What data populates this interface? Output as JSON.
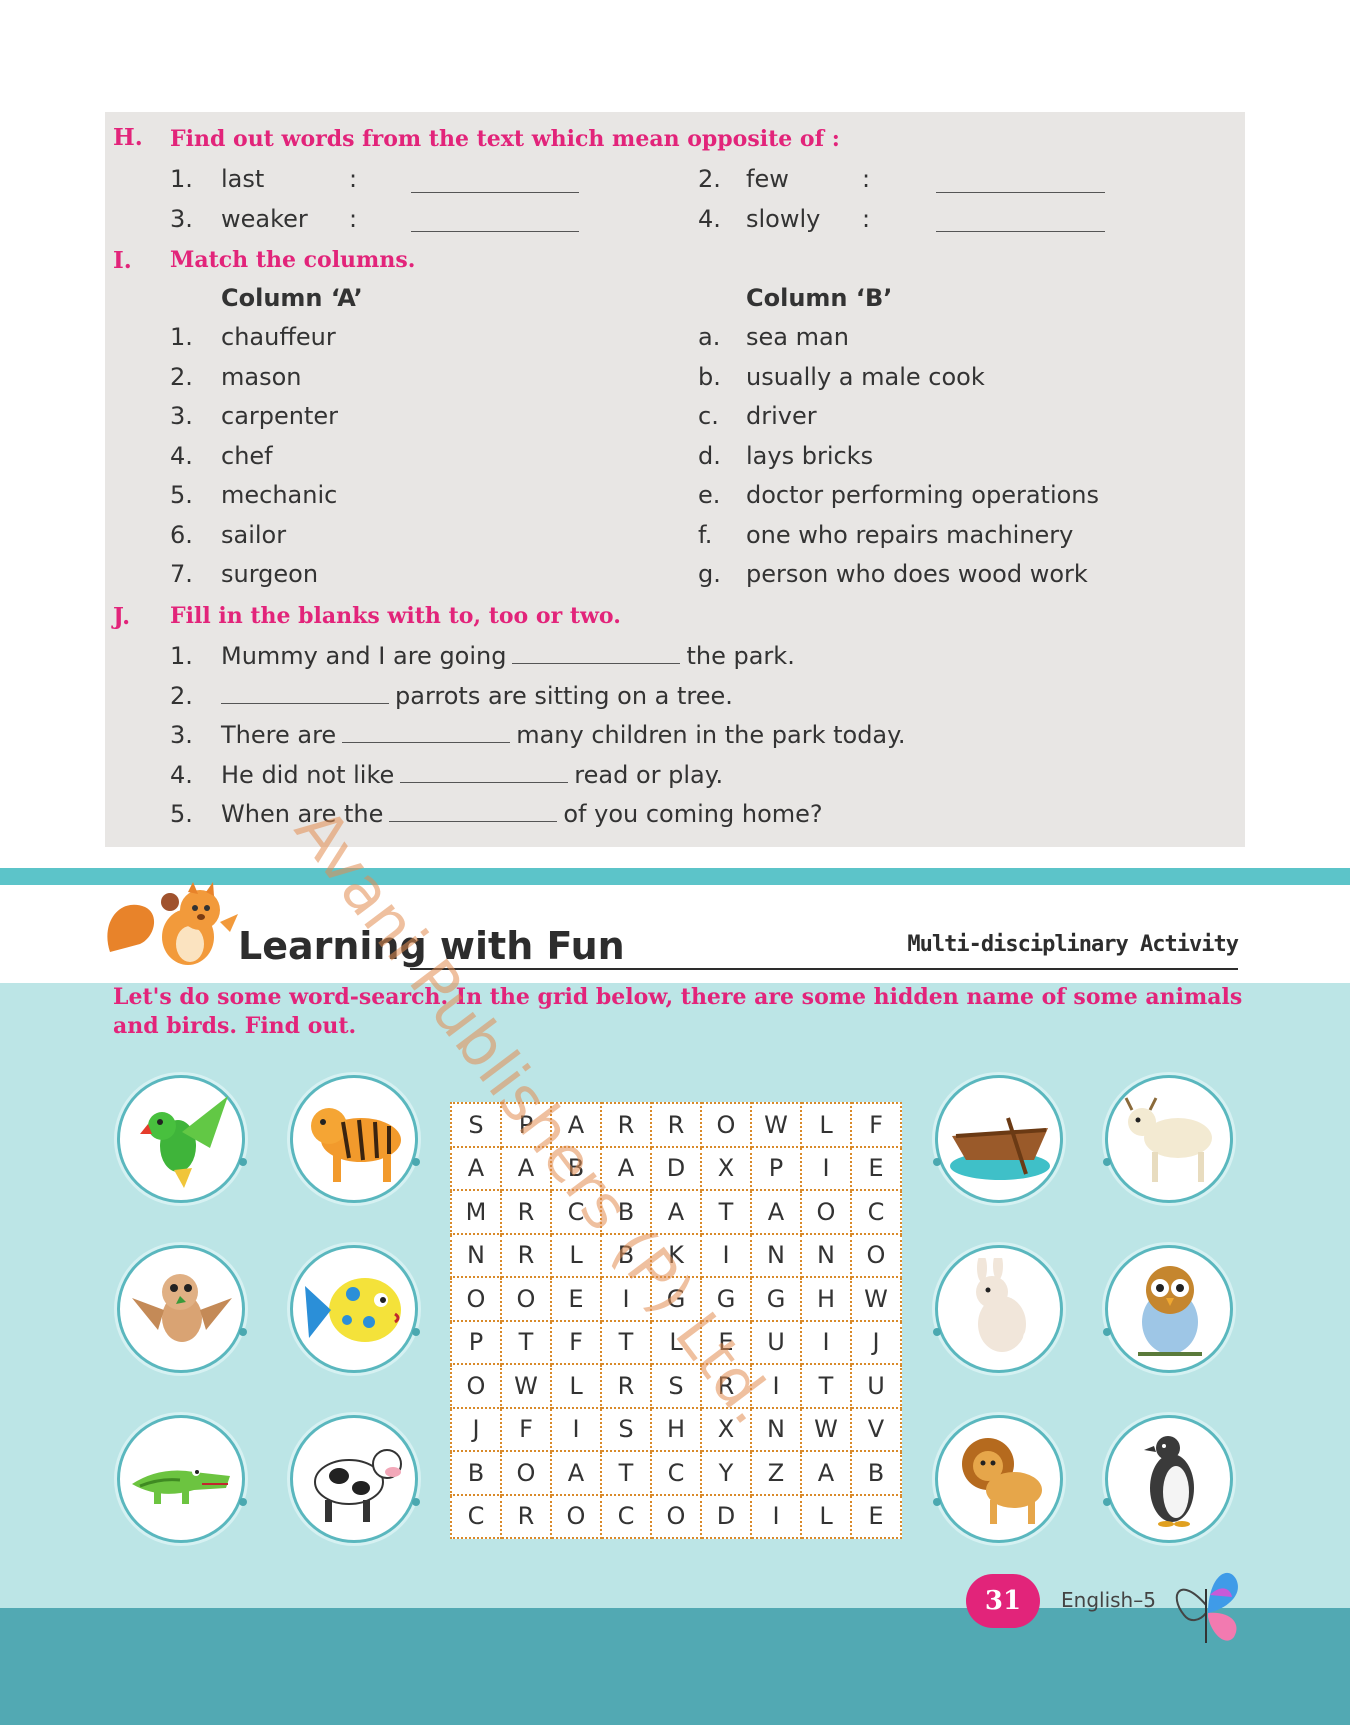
{
  "section_h": {
    "letter": "H.",
    "title": "Find out words from the text which mean opposite of :",
    "items": [
      {
        "num": "1.",
        "word": "last"
      },
      {
        "num": "2.",
        "word": "few"
      },
      {
        "num": "3.",
        "word": "weaker"
      },
      {
        "num": "4.",
        "word": "slowly"
      }
    ],
    "colon": ":"
  },
  "section_i": {
    "letter": "I.",
    "title": "Match the columns.",
    "col_a_head": "Column ‘A’",
    "col_b_head": "Column ‘B’",
    "col_a": [
      {
        "num": "1.",
        "text": "chauffeur"
      },
      {
        "num": "2.",
        "text": "mason"
      },
      {
        "num": "3.",
        "text": "carpenter"
      },
      {
        "num": "4.",
        "text": "chef"
      },
      {
        "num": "5.",
        "text": "mechanic"
      },
      {
        "num": "6.",
        "text": "sailor"
      },
      {
        "num": "7.",
        "text": "surgeon"
      }
    ],
    "col_b": [
      {
        "num": "a.",
        "text": "sea man"
      },
      {
        "num": "b.",
        "text": "usually a male cook"
      },
      {
        "num": "c.",
        "text": "driver"
      },
      {
        "num": "d.",
        "text": "lays bricks"
      },
      {
        "num": "e.",
        "text": "doctor performing operations"
      },
      {
        "num": "f.",
        "text": "one who repairs machinery"
      },
      {
        "num": "g.",
        "text": "person who does wood work"
      }
    ]
  },
  "section_j": {
    "letter": "J.",
    "title": "Fill in the blanks with to, too or two.",
    "items": [
      {
        "num": "1.",
        "before": "Mummy and I are going",
        "after": "the park."
      },
      {
        "num": "2.",
        "before": "",
        "after": "parrots are sitting on a tree."
      },
      {
        "num": "3.",
        "before": "There are",
        "after": "many children in the park today."
      },
      {
        "num": "4.",
        "before": "He did not like",
        "after": "read or play."
      },
      {
        "num": "5.",
        "before": "When are the",
        "after": "of you coming home?"
      }
    ]
  },
  "fun": {
    "title": "Learning with Fun",
    "tag": "Multi-disciplinary Activity",
    "instruction": "Let's do some word-search. In the grid below, there are some hidden name of some animals and birds. Find out."
  },
  "grid": [
    [
      "S",
      "P",
      "A",
      "R",
      "R",
      "O",
      "W",
      "L",
      "F"
    ],
    [
      "A",
      "A",
      "B",
      "A",
      "D",
      "X",
      "P",
      "I",
      "E"
    ],
    [
      "M",
      "R",
      "C",
      "B",
      "A",
      "T",
      "A",
      "O",
      "C"
    ],
    [
      "N",
      "R",
      "L",
      "B",
      "K",
      "I",
      "N",
      "N",
      "O"
    ],
    [
      "O",
      "O",
      "E",
      "I",
      "G",
      "G",
      "G",
      "H",
      "W"
    ],
    [
      "P",
      "T",
      "F",
      "T",
      "L",
      "E",
      "U",
      "I",
      "J"
    ],
    [
      "O",
      "W",
      "L",
      "R",
      "S",
      "R",
      "I",
      "T",
      "U"
    ],
    [
      "J",
      "F",
      "I",
      "S",
      "H",
      "X",
      "N",
      "W",
      "V"
    ],
    [
      "B",
      "O",
      "A",
      "T",
      "C",
      "Y",
      "Z",
      "A",
      "B"
    ],
    [
      "C",
      "R",
      "O",
      "C",
      "O",
      "D",
      "I",
      "L",
      "E"
    ]
  ],
  "pictures": [
    "parrot",
    "tiger",
    "sparrow",
    "fish",
    "crocodile",
    "cow",
    "boat",
    "ox",
    "rabbit",
    "owl",
    "lion",
    "penguin"
  ],
  "footer": {
    "page": "31",
    "book": "English–5"
  },
  "watermark": "Avani Publishers (P) Ltd.",
  "colors": {
    "pink": "#e2247a",
    "teal": "#5cc4c9",
    "light_teal": "#bce5e6",
    "footer_teal": "#52a9b3",
    "grey_box": "#e8e6e4"
  }
}
